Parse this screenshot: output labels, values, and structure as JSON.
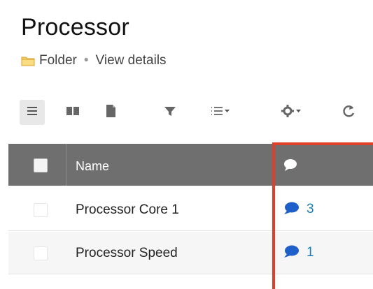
{
  "page": {
    "title": "Processor"
  },
  "subline": {
    "folder_label": "Folder",
    "separator": "•",
    "view_details": "View details"
  },
  "toolbar": {
    "buttons": [
      {
        "icon": "list-view-icon",
        "active": true
      },
      {
        "icon": "board-view-icon"
      },
      {
        "icon": "document-view-icon"
      },
      {
        "icon": "filter-icon"
      },
      {
        "icon": "sort-icon"
      },
      {
        "icon": "settings-icon"
      },
      {
        "icon": "refresh-icon"
      }
    ]
  },
  "table": {
    "headers": {
      "name": "Name"
    },
    "rows": [
      {
        "name": "Processor Core 1",
        "comments": "3"
      },
      {
        "name": "Processor Speed",
        "comments": "1"
      }
    ]
  },
  "colors": {
    "header_bg": "#6f6f6f",
    "accent_blue": "#1a7db7",
    "highlight_red": "#e0402a",
    "folder_yellow": "#f2c14e"
  }
}
